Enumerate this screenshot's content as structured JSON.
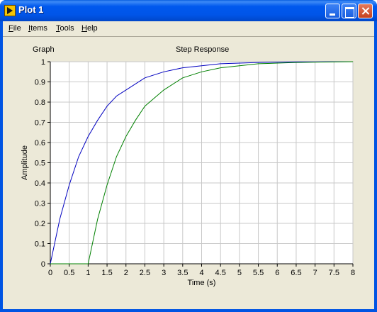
{
  "window": {
    "title": "Plot 1"
  },
  "menu": {
    "items": [
      {
        "mnemonic": "F",
        "rest": "ile"
      },
      {
        "mnemonic": "I",
        "rest": "tems"
      },
      {
        "mnemonic": "T",
        "rest": "ools"
      },
      {
        "mnemonic": "H",
        "rest": "elp"
      }
    ]
  },
  "graph": {
    "label": "Graph"
  },
  "chart_data": {
    "type": "line",
    "title": "Step Response",
    "xlabel": "Time (s)",
    "ylabel": "Amplitude",
    "xlim": [
      0,
      8
    ],
    "ylim": [
      0,
      1
    ],
    "xticks": [
      0,
      0.5,
      1,
      1.5,
      2,
      2.5,
      3,
      3.5,
      4,
      4.5,
      5,
      5.5,
      6,
      6.5,
      7,
      7.5,
      8
    ],
    "yticks": [
      0,
      0.1,
      0.2,
      0.3,
      0.4,
      0.5,
      0.6,
      0.7,
      0.8,
      0.9,
      1
    ],
    "xtick_labels": [
      "0",
      "0.5",
      "1",
      "1.5",
      "2",
      "2.5",
      "3",
      "3.5",
      "4",
      "4.5",
      "5",
      "5.5",
      "6",
      "6.5",
      "7",
      "7.5",
      "8"
    ],
    "ytick_labels": [
      "0",
      "0.1",
      "0.2",
      "0.3",
      "0.4",
      "0.5",
      "0.6",
      "0.7",
      "0.8",
      "0.9",
      "1"
    ],
    "grid": true,
    "series": [
      {
        "color": "#0000c0",
        "x": [
          0,
          0.25,
          0.5,
          0.75,
          1,
          1.25,
          1.5,
          1.75,
          2,
          2.5,
          3,
          3.5,
          4,
          4.5,
          5,
          5.5,
          6,
          6.5,
          7,
          7.5,
          8
        ],
        "y": [
          0,
          0.22,
          0.39,
          0.53,
          0.63,
          0.71,
          0.78,
          0.83,
          0.86,
          0.92,
          0.95,
          0.97,
          0.98,
          0.99,
          0.993,
          0.996,
          0.998,
          0.999,
          0.999,
          1,
          1
        ]
      },
      {
        "color": "#008000",
        "x": [
          0,
          1,
          1.25,
          1.5,
          1.75,
          2,
          2.25,
          2.5,
          3,
          3.5,
          4,
          4.5,
          5,
          5.5,
          6,
          6.5,
          7,
          7.5,
          8
        ],
        "y": [
          0,
          0,
          0.22,
          0.39,
          0.53,
          0.63,
          0.71,
          0.78,
          0.86,
          0.92,
          0.95,
          0.97,
          0.98,
          0.99,
          0.993,
          0.996,
          0.998,
          0.999,
          1
        ]
      }
    ]
  }
}
